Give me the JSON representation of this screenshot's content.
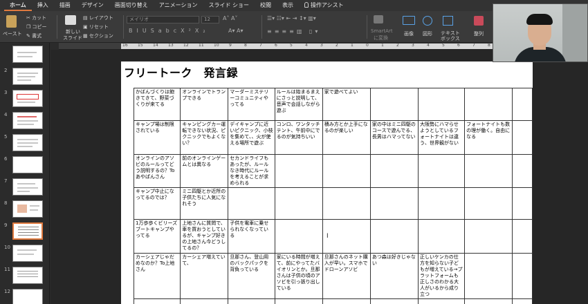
{
  "tabs": [
    {
      "label": "ホーム",
      "active": true
    },
    {
      "label": "挿入"
    },
    {
      "label": "描画"
    },
    {
      "label": "デザイン"
    },
    {
      "label": "画面切り替え"
    },
    {
      "label": "アニメーション"
    },
    {
      "label": "スライド ショー"
    },
    {
      "label": "校閲"
    },
    {
      "label": "表示"
    },
    {
      "label": "操作アシスト"
    }
  ],
  "ribbon": {
    "paste": "ペースト",
    "cut": "カット",
    "copy": "コピー",
    "format": "書式",
    "new_slide_line1": "新しい",
    "new_slide_line2": "スライド",
    "layout": "レイアウト",
    "reset": "リセット",
    "section": "セクション",
    "font_name": "メイリオ",
    "font_size": "12",
    "smartart_line1": "SmartArt",
    "smartart_line2": "に変換",
    "picture": "画像",
    "shape": "図形",
    "textbox_line1": "テキスト",
    "textbox_line2": "ボックス",
    "arrange": "整列"
  },
  "ruler_labels": [
    "16",
    "15",
    "14",
    "13",
    "12",
    "11",
    "10",
    "9",
    "8",
    "7",
    "6",
    "5",
    "4",
    "3",
    "2",
    "1",
    "0",
    "1",
    "2",
    "3",
    "4",
    "5",
    "6",
    "7",
    "8",
    "9",
    "10"
  ],
  "thumbnails": [
    {
      "num": ""
    },
    {
      "num": "2"
    },
    {
      "num": "3"
    },
    {
      "num": "4"
    },
    {
      "num": "5"
    },
    {
      "num": "6"
    },
    {
      "num": "7"
    },
    {
      "num": "8"
    },
    {
      "num": "9",
      "selected": true
    },
    {
      "num": "10"
    },
    {
      "num": "11"
    },
    {
      "num": "12"
    }
  ],
  "slide": {
    "title": "フリートーク　発言録",
    "rows": [
      [
        "かばんづくりは飽きてきて、野菜づくりが来てる",
        "オンラインでトランプできる",
        "マーダーミステリーコミュニティやってる",
        "ルールは始まるまえにさっと説明して、音声で会話しながら遊ぶ",
        "家で遊べてよい",
        "",
        "",
        "",
        ""
      ],
      [
        "キャンプ場は制限されている",
        "キャンピングカー運転できない状況、ピクニックでもよくない？",
        "デイキャンプに近いピクニック、小枝を集めて、、火が使える場所で遊ぶ",
        "コンロ、ワンタッチテント、午前中にでるのが気持ちいい",
        "積み方とか上手になるのが楽しい",
        "家の中はミニ四駆のコースで遊んでる、長男はハマってない",
        "大阪勢にハマらせようとしているフォートナイトは違う、世界観がない",
        "フォートナイトも数の理が働く。自由になる",
        ""
      ],
      [
        "オンラインのアソビのルールってどう説明するの？Toあやぱんさん",
        "前のオンラインゲームとは異なる",
        "セカンドライフもあったが、ルールなき時代にルールを考えることが求められる",
        "",
        "",
        "",
        "",
        "",
        ""
      ],
      [
        "キャンプ中止になってるのでは？",
        "ミニ四駆とか近所の子供たちに人気になれそう",
        "",
        "",
        "",
        "",
        "",
        "",
        ""
      ],
      [
        "1万歩歩くビリーズブートキャンプやってる",
        "上地さんに質問で、車を買おうとしているが、キャンプ好きの上地さん今どうしてるの？",
        "子供を電車に乗せられなくなっている",
        "",
        "",
        "",
        "",
        "",
        ""
      ],
      [
        "カーシェアじゃだめなのか？To上地さん",
        "カーシェア増えていて、",
        "旦那さん、登山用のバックパックを背負っている",
        "家にいる時間が増えて、前にやってたバイオリンとか。旦那さんは子供の頃のアソビを引っ張り出している",
        "旦那さんのネット購入が早い。スマホでドローンアソビ",
        "あつ森は好きじゃない",
        "正しいケンカの仕方を知らない子どもが増えている→プラットフォームも正しさのわかる大人がいるから成り立つ",
        "",
        ""
      ],
      [
        "",
        "",
        "",
        "",
        "",
        "",
        "",
        "",
        ""
      ]
    ]
  }
}
